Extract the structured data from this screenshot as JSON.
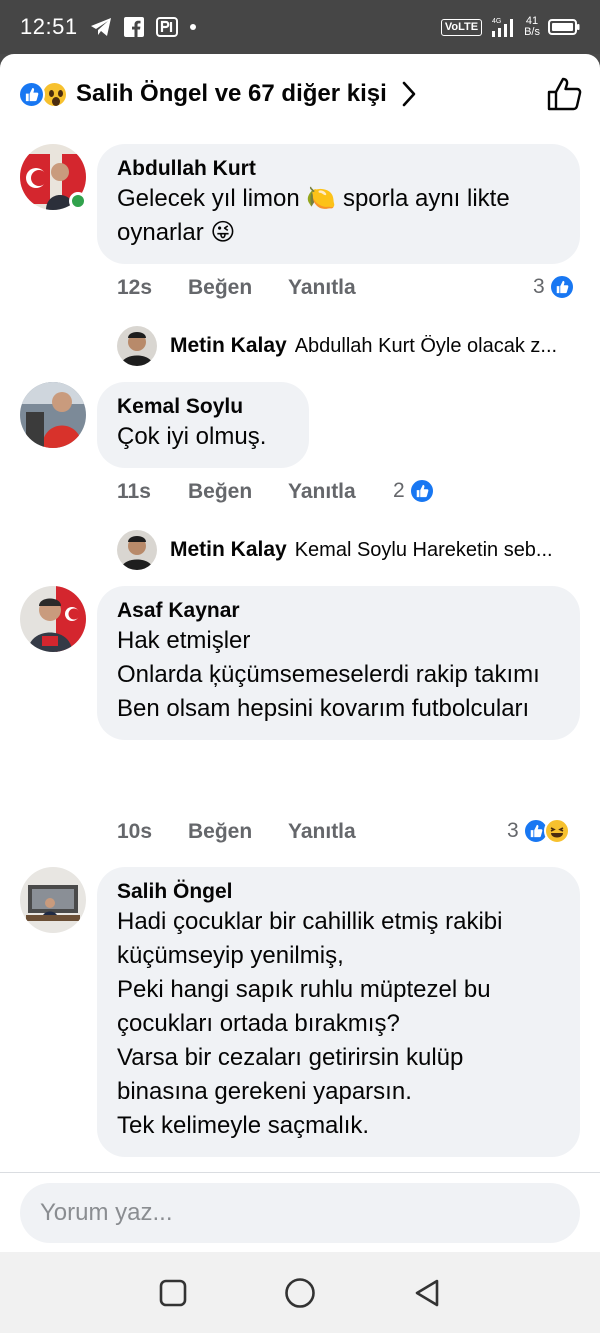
{
  "status_bar": {
    "time": "12:51",
    "network_label": "VoLTE",
    "network_gen": "4G",
    "speed_value": "41",
    "speed_unit": "B/s"
  },
  "header": {
    "title": "Salih Öngel ve 67 diğer kişi"
  },
  "comments": [
    {
      "author": "Abdullah Kurt",
      "text": "Gelecek yıl limon 🍋 sporla aynı likte oynarlar 😜",
      "age": "12s",
      "like_label": "Beğen",
      "reply_label": "Yanıtla",
      "reaction_count": "3",
      "online": true,
      "reply": {
        "author": "Metin Kalay",
        "text": "Abdullah Kurt Öyle olacak z..."
      }
    },
    {
      "author": "Kemal Soylu",
      "text": "Çok iyi olmuş.",
      "age": "11s",
      "like_label": "Beğen",
      "reply_label": "Yanıtla",
      "reaction_count": "2",
      "reply": {
        "author": "Metin Kalay",
        "text": "Kemal Soylu Hareketin seb..."
      }
    },
    {
      "author": "Asaf Kaynar",
      "text": "Hak etmişler\nOnlarda ķüçümsemeselerdi rakip takımı\nBen olsam hepsini kovarım futbolcuları",
      "age": "10s",
      "like_label": "Beğen",
      "reply_label": "Yanıtla",
      "reaction_count": "3"
    },
    {
      "author": "Salih Öngel",
      "text": "Hadi çocuklar bir cahillik etmiş rakibi küçümseyip yenilmiş,\nPeki hangi sapık ruhlu müptezel bu çocukları ortada bırakmış?\nVarsa bir cezaları getirirsin kulüp binasına gerekeni yaparsın.\nTek kelimeyle saçmalık."
    }
  ],
  "composer": {
    "placeholder": "Yorum yaz..."
  },
  "colors": {
    "accent": "#1877f2",
    "bubble": "#f0f2f5",
    "muted_text": "#65676b",
    "online": "#31a24c"
  }
}
